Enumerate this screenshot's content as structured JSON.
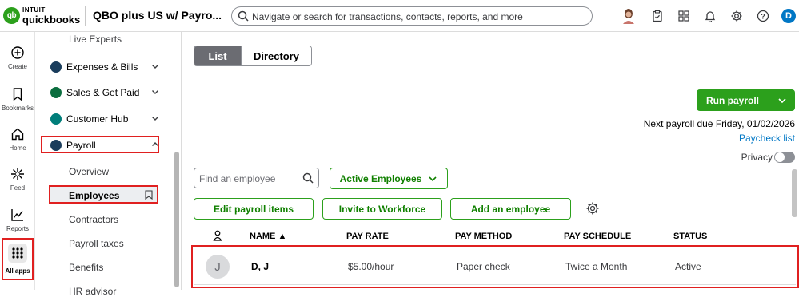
{
  "topbar": {
    "logo_line1": "INTUIT",
    "logo_line2": "quickbooks",
    "logo_mark": "qb",
    "company": "QBO plus US w/ Payro...",
    "search_placeholder": "Navigate or search for transactions, contacts, reports, and more",
    "user_initial": "D",
    "icons": [
      "user-photo-icon",
      "clipboard-icon",
      "apps-grid-icon",
      "bell-icon",
      "gear-icon",
      "help-icon"
    ]
  },
  "rail": {
    "create": "Create",
    "bookmarks": "Bookmarks",
    "home": "Home",
    "feed": "Feed",
    "reports": "Reports",
    "all_apps": "All apps"
  },
  "sidenav": {
    "live_experts": "Live Experts",
    "expenses": "Expenses & Bills",
    "sales": "Sales & Get Paid",
    "customer_hub": "Customer Hub",
    "payroll": "Payroll",
    "overview": "Overview",
    "employees": "Employees",
    "contractors": "Contractors",
    "payroll_taxes": "Payroll taxes",
    "benefits": "Benefits",
    "hr_advisor": "HR advisor"
  },
  "main": {
    "tab_list": "List",
    "tab_directory": "Directory",
    "run_payroll": "Run payroll",
    "next_payroll": "Next payroll due Friday, 01/02/2026",
    "paycheck_list": "Paycheck list",
    "privacy": "Privacy",
    "find_placeholder": "Find an employee",
    "filter_label": "Active Employees",
    "edit_payroll_items": "Edit payroll items",
    "invite_workforce": "Invite to Workforce",
    "add_employee": "Add an employee"
  },
  "table": {
    "headers": {
      "name": "NAME ▲",
      "pay_rate": "PAY RATE",
      "pay_method": "PAY METHOD",
      "pay_schedule": "PAY SCHEDULE",
      "status": "STATUS"
    },
    "rows": [
      {
        "initial": "J",
        "name": "D, J",
        "pay_rate": "$5.00/hour",
        "pay_method": "Paper check",
        "pay_schedule": "Twice a Month",
        "status": "Active"
      }
    ]
  },
  "colors": {
    "brand_green": "#2ca01c",
    "highlight_red": "#e02020",
    "link_blue": "#0077c5"
  }
}
